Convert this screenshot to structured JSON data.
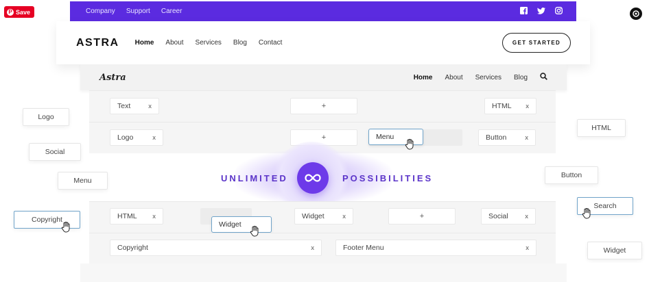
{
  "pinterest": {
    "save_label": "Save"
  },
  "topbar": {
    "links": [
      "Company",
      "Support",
      "Career"
    ],
    "socials": [
      "facebook-icon",
      "twitter-icon",
      "instagram-icon"
    ],
    "color": "#5b2be0"
  },
  "header": {
    "brand": "ASTRA",
    "nav": [
      "Home",
      "About",
      "Services",
      "Blog",
      "Contact"
    ],
    "cta": "GET STARTED"
  },
  "preview": {
    "logo": "Astra",
    "nav": [
      "Home",
      "About",
      "Services",
      "Blog"
    ]
  },
  "builder": {
    "row1": {
      "text_chip": "Text",
      "html_chip": "HTML",
      "plus": "+"
    },
    "row2": {
      "logo_chip": "Logo",
      "plus": "+",
      "menu_chip": "Menu",
      "button_chip": "Button"
    },
    "tagline": {
      "left": "UNLIMITED",
      "right": "POSSIBILITIES"
    },
    "row3": {
      "html_chip": "HTML",
      "widget_drag": "Widget",
      "widget_chip": "Widget",
      "plus": "+",
      "social_chip": "Social"
    },
    "row4": {
      "copyright_chip": "Copyright",
      "footer_menu_chip": "Footer Menu"
    },
    "close": "x"
  },
  "side_tags": {
    "logo": "Logo",
    "social": "Social",
    "menu": "Menu",
    "copyright": "Copyright",
    "html": "HTML",
    "button": "Button",
    "search": "Search",
    "widget": "Widget"
  },
  "accent": "#6d3ae9"
}
